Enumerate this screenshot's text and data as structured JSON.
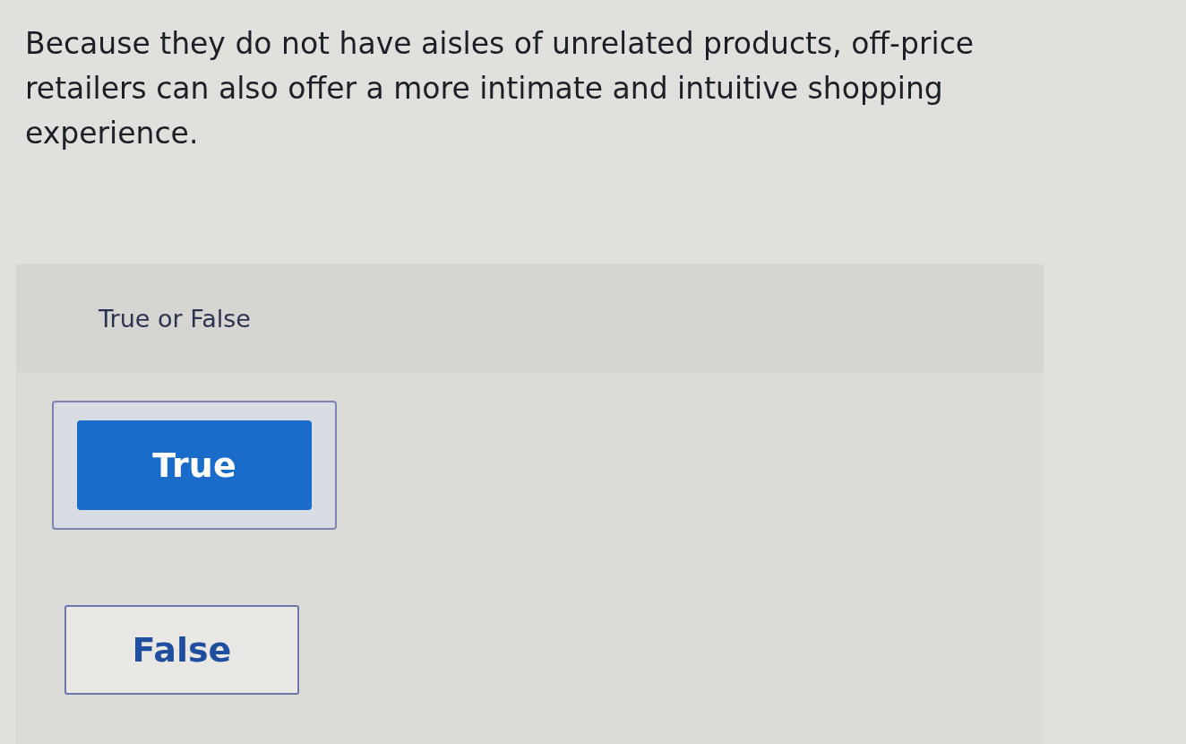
{
  "question": {
    "text": "Because they do not have aisles of unrelated products, off-price retailers can also offer a more intimate and intuitive shopping experience."
  },
  "answer_panel": {
    "prompt": "True or False",
    "options": [
      {
        "label": "True",
        "selected": true
      },
      {
        "label": "False",
        "selected": false
      }
    ]
  }
}
